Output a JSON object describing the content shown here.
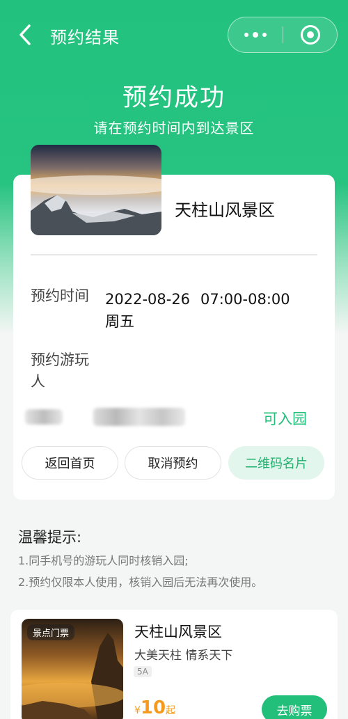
{
  "nav": {
    "title": "预约结果",
    "back_icon": "chevron-left-icon",
    "more_icon": "more-dots-icon",
    "close_icon": "target-icon"
  },
  "hero": {
    "title": "预约成功",
    "subtitle": "请在预约时间内到达景区"
  },
  "booking": {
    "scenic_name": "天柱山风景区",
    "time_label": "预约时间",
    "date": "2022-08-26",
    "time_range": "07:00-08:00",
    "weekday": "周五",
    "visitor_label_line1": "预约游玩",
    "visitor_label_line2": "人",
    "visitor_status": "可入园"
  },
  "actions": {
    "home_label": "返回首页",
    "cancel_label": "取消预约",
    "qrcode_label": "二维码名片"
  },
  "tips": {
    "title": "温馨提示:",
    "items": [
      "1.同手机号的游玩人同时核销入园;",
      "2.预约仅限本人使用，核销入园后无法再次使用。"
    ]
  },
  "product": {
    "tag": "景点门票",
    "name": "天柱山风景区",
    "slogan": "大美天柱 情系天下",
    "level": "5A",
    "currency": "¥",
    "price": "10",
    "price_suffix": "起",
    "buy_label": "去购票"
  },
  "colors": {
    "primary": "#22bf7a",
    "price": "#f59a1c"
  }
}
